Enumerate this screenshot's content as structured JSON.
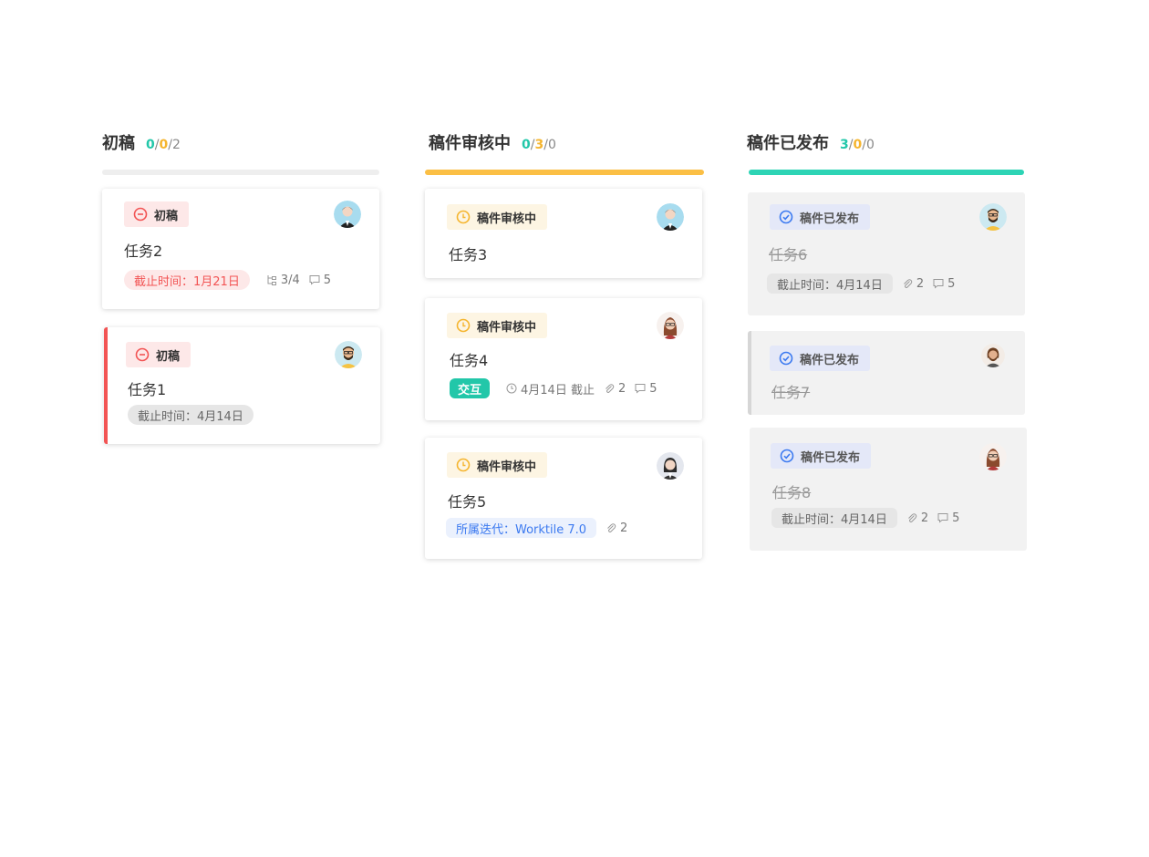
{
  "columns": [
    {
      "title": "初稿",
      "count": {
        "a": "0",
        "b": "0",
        "c": "2"
      },
      "bar_color": "#eeeeee"
    },
    {
      "title": "稿件审核中",
      "count": {
        "a": "0",
        "b": "3",
        "c": "0"
      },
      "bar_color": "#fbbf45"
    },
    {
      "title": "稿件已发布",
      "count": {
        "a": "3",
        "b": "0",
        "c": "0"
      },
      "bar_color": "#2dd4b5"
    }
  ],
  "cards": {
    "task2": {
      "status": "初稿",
      "title": "任务2",
      "due": "截止时间：1月21日",
      "subtasks": "3/4",
      "comments": "5"
    },
    "task1": {
      "status": "初稿",
      "title": "任务1",
      "due": "截止时间：4月14日"
    },
    "task3": {
      "status": "稿件审核中",
      "title": "任务3"
    },
    "task4": {
      "status": "稿件审核中",
      "title": "任务4",
      "tag": "交互",
      "deadline": "4月14日 截止",
      "attachments": "2",
      "comments": "5"
    },
    "task5": {
      "status": "稿件审核中",
      "title": "任务5",
      "iteration": "所属迭代：Worktile 7.0",
      "attachments": "2"
    },
    "task6": {
      "status": "稿件已发布",
      "title": "任务6",
      "due": "截止时间：4月14日",
      "attachments": "2",
      "comments": "5"
    },
    "task7": {
      "status": "稿件已发布",
      "title": "任务7"
    },
    "task8": {
      "status": "稿件已发布",
      "title": "任务8",
      "due": "截止时间：4月14日",
      "attachments": "2",
      "comments": "5"
    }
  },
  "colors": {
    "red": "#f25454",
    "yellow": "#f5b52f",
    "green": "#22c7a9",
    "blue": "#3c7af0"
  },
  "icons": [
    "minus-circle-icon",
    "clock-icon",
    "check-circle-icon",
    "subtask-icon",
    "comment-icon",
    "attachment-icon",
    "avatar"
  ]
}
